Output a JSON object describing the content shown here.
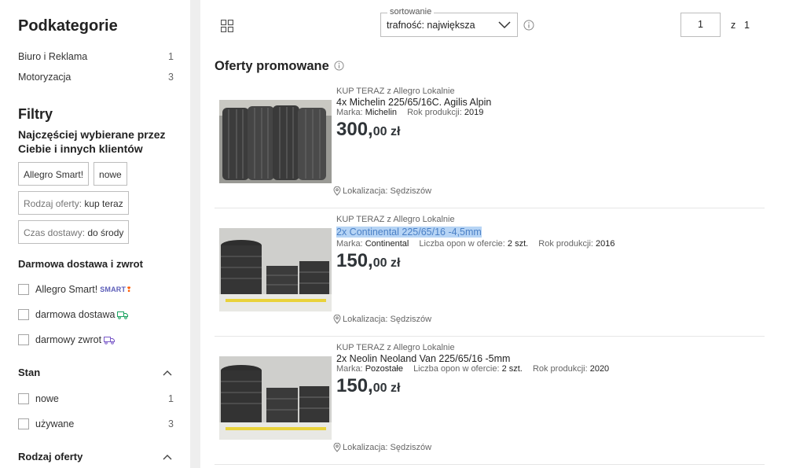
{
  "sidebar": {
    "subcategories_title": "Podkategorie",
    "subcategories": [
      {
        "label": "Biuro i Reklama",
        "count": "1"
      },
      {
        "label": "Motoryzacja",
        "count": "3"
      }
    ],
    "filters_title": "Filtry",
    "popular_title": "Najczęściej wybierane przez Ciebie i innych klientów",
    "chips": [
      {
        "label": "",
        "value": "Allegro Smart!"
      },
      {
        "label": "",
        "value": "nowe"
      },
      {
        "label": "Rodzaj oferty: ",
        "value": "kup teraz"
      },
      {
        "label": "Czas dostawy: ",
        "value": "do środy"
      }
    ],
    "free_title": "Darmowa dostawa i zwrot",
    "free_options": [
      {
        "label": "Allegro Smart!",
        "badge": "SMART"
      },
      {
        "label": "darmowa dostawa"
      },
      {
        "label": "darmowy zwrot"
      }
    ],
    "stan_title": "Stan",
    "stan_options": [
      {
        "label": "nowe",
        "count": "1"
      },
      {
        "label": "używane",
        "count": "3"
      }
    ],
    "rodzaj_title": "Rodzaj oferty"
  },
  "toolbar": {
    "sort_label": "sortowanie",
    "sort_value": "trafność: największa",
    "page_current": "1",
    "page_of": "z",
    "page_total": "1"
  },
  "promoted_title": "Oferty promowane",
  "offers": [
    {
      "kind": "KUP TERAZ z Allegro Lokalnie",
      "title": "4x Michelin 225/65/16C. Agilis Alpin",
      "params": [
        {
          "name": "Marka:",
          "value": "Michelin"
        },
        {
          "name": "Rok produkcji:",
          "value": "2019"
        }
      ],
      "price_int": "300,",
      "price_dec": "00 zł",
      "location": "Lokalizacja: Sędziszów"
    },
    {
      "kind": "KUP TERAZ z Allegro Lokalnie",
      "title": "2x Continental 225/65/16 -4,5mm",
      "params": [
        {
          "name": "Marka:",
          "value": "Continental"
        },
        {
          "name": "Liczba opon w ofercie:",
          "value": "2 szt."
        },
        {
          "name": "Rok produkcji:",
          "value": "2016"
        }
      ],
      "price_int": "150,",
      "price_dec": "00 zł",
      "location": "Lokalizacja: Sędziszów"
    },
    {
      "kind": "KUP TERAZ z Allegro Lokalnie",
      "title": "2x Neolin Neoland Van 225/65/16 -5mm",
      "params": [
        {
          "name": "Marka:",
          "value": "Pozostałe"
        },
        {
          "name": "Liczba opon w ofercie:",
          "value": "2 szt."
        },
        {
          "name": "Rok produkcji:",
          "value": "2020"
        }
      ],
      "price_int": "150,",
      "price_dec": "00 zł",
      "location": "Lokalizacja: Sędziszów"
    }
  ]
}
